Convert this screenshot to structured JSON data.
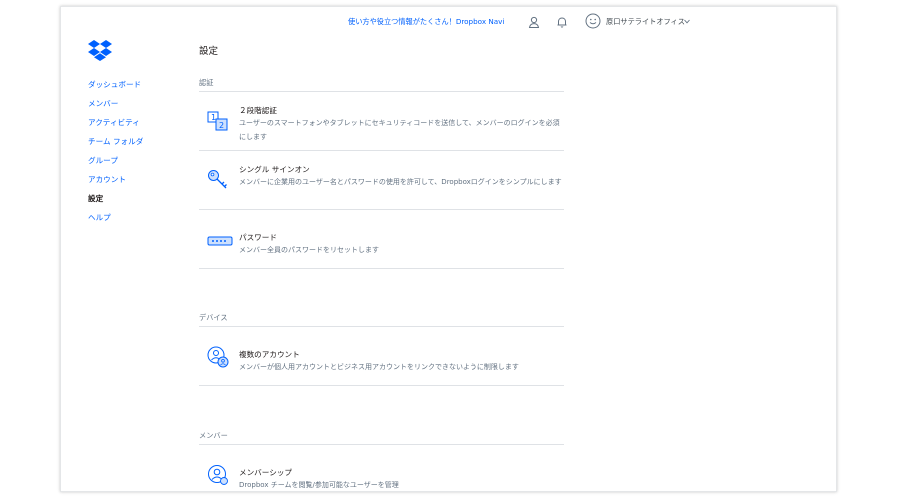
{
  "header": {
    "navi_link": "使い方や役立つ情報がたくさん！Dropbox Navi",
    "account_name": "原口サテライトオフィス"
  },
  "sidebar": {
    "items": [
      {
        "label": "ダッシュボード"
      },
      {
        "label": "メンバー"
      },
      {
        "label": "アクティビティ"
      },
      {
        "label": "チーム フォルダ"
      },
      {
        "label": "グループ"
      },
      {
        "label": "アカウント"
      },
      {
        "label": "設定"
      },
      {
        "label": "ヘルプ"
      }
    ],
    "active_label": "設定"
  },
  "main": {
    "page_title": "設定",
    "sections": [
      {
        "label": "認証",
        "items": [
          {
            "title": "２段階認証",
            "description": "ユーザーのスマートフォンやタブレットにセキュリティコードを送信して、メンバーのログインを必須にします",
            "icon": "two-step-icon"
          },
          {
            "title": "シングル サインオン",
            "description": "メンバーに企業用のユーザー名とパスワードの使用を許可して、Dropboxログインをシンプルにします",
            "icon": "key-icon"
          },
          {
            "title": "パスワード",
            "description": "メンバー全員のパスワードをリセットします",
            "icon": "password-icon"
          }
        ]
      },
      {
        "label": "デバイス",
        "items": [
          {
            "title": "複数のアカウント",
            "description": "メンバーが個人用アカウントとビジネス用アカウントをリンクできないように制限します",
            "icon": "multi-account-icon"
          }
        ]
      },
      {
        "label": "メンバー",
        "items": [
          {
            "title": "メンバーシップ",
            "description": "Dropbox チームを閲覧/参加可能なユーザーを管理",
            "icon": "membership-icon"
          }
        ]
      }
    ]
  },
  "colors": {
    "link": "#0061fe",
    "text": "#1e1919",
    "muted": "#637282",
    "divider": "#dfe2e6"
  }
}
